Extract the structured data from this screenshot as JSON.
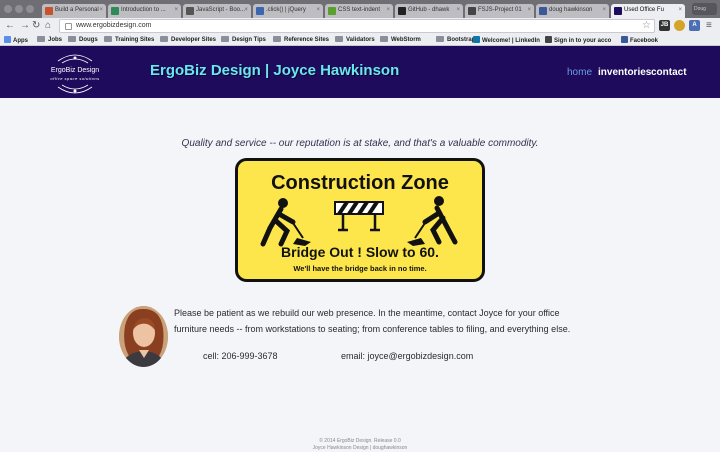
{
  "browser": {
    "tabs": [
      {
        "title": "Build a Personal",
        "favicon_color": "#c8522a"
      },
      {
        "title": "Introduction to ...",
        "favicon_color": "#2e8b57"
      },
      {
        "title": "JavaScript - Boo...",
        "favicon_color": "#555555"
      },
      {
        "title": ".click() | jQuery",
        "favicon_color": "#3b66b0"
      },
      {
        "title": "CSS text-indent",
        "favicon_color": "#5aa02c"
      },
      {
        "title": "GitHub - dhawk",
        "favicon_color": "#222222"
      },
      {
        "title": "FSJS-Project 01",
        "favicon_color": "#444444"
      },
      {
        "title": "doug hawkinson",
        "favicon_color": "#3b5998"
      },
      {
        "title": "Used Office Fu",
        "favicon_color": "#1e0b5c"
      }
    ],
    "profile_label": "Doug",
    "url": "www.ergobizdesign.com",
    "bookmarks": [
      {
        "label": "Apps",
        "kind": "apps"
      },
      {
        "label": "Jobs",
        "kind": "folder"
      },
      {
        "label": "Dougs",
        "kind": "folder"
      },
      {
        "label": "Training Sites",
        "kind": "folder"
      },
      {
        "label": "Developer Sites",
        "kind": "folder"
      },
      {
        "label": "Design Tips",
        "kind": "folder"
      },
      {
        "label": "Reference Sites",
        "kind": "folder"
      },
      {
        "label": "Validators",
        "kind": "folder"
      },
      {
        "label": "WebStorm",
        "kind": "folder"
      },
      {
        "label": "Bootstrap",
        "kind": "folder"
      },
      {
        "label": "Welcome! | LinkedIn",
        "kind": "linkedin"
      },
      {
        "label": "Sign in to your acco",
        "kind": "site"
      },
      {
        "label": "Facebook",
        "kind": "facebook"
      }
    ]
  },
  "site": {
    "logo_name": "ErgoBiz Design",
    "logo_tagline": "office space solutions",
    "brand": "ErgoBiz Design | Joyce Hawkinson",
    "nav": [
      {
        "label": "home",
        "active": true
      },
      {
        "label": "inventories",
        "active": false
      },
      {
        "label": "contact",
        "active": false
      }
    ],
    "header_color": "#1e0b5c",
    "brand_color": "#6be6ee"
  },
  "main": {
    "tagline": "Quality and service -- our reputation is at stake, and that's a valuable commodity.",
    "sign": {
      "title": "Construction Zone",
      "subtitle": "Bridge Out !  Slow to 60.",
      "note": "We'll have the bridge back in no time.",
      "color": "#fde64b"
    },
    "body": "Please be patient as we rebuild our web presence. In the meantime, contact Joyce for your office furniture needs -- from workstations to seating; from conference tables to filing, and everything else.",
    "cell": "cell: 206-999-3678",
    "email": "email: joyce@ergobizdesign.com"
  },
  "footer": {
    "line1": "© 2014 ErgoBiz Design. Release 0.0",
    "line2": "Joyce Hawkinson Design | doughawkinson"
  }
}
